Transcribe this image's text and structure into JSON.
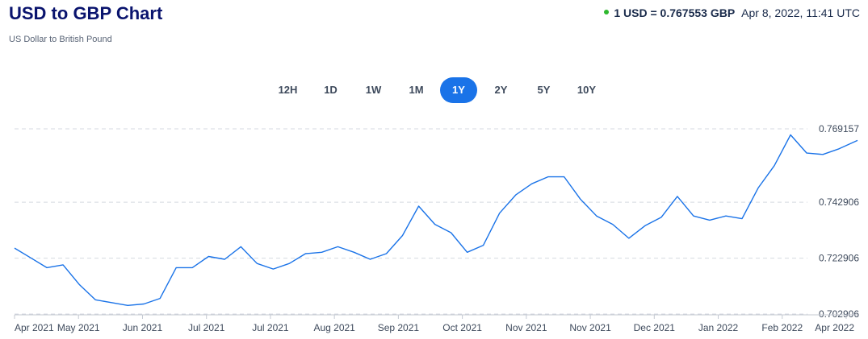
{
  "header": {
    "title": "USD to GBP Chart",
    "subtitle": "US Dollar to British Pound",
    "rate": "1 USD = 0.767553 GBP",
    "timestamp": "Apr 8, 2022, 11:41 UTC",
    "live_dot_color": "#2eb82e"
  },
  "ranges": [
    {
      "label": "12H",
      "active": false
    },
    {
      "label": "1D",
      "active": false
    },
    {
      "label": "1W",
      "active": false
    },
    {
      "label": "1M",
      "active": false
    },
    {
      "label": "1Y",
      "active": true
    },
    {
      "label": "2Y",
      "active": false
    },
    {
      "label": "5Y",
      "active": false
    },
    {
      "label": "10Y",
      "active": false
    }
  ],
  "chart_data": {
    "type": "line",
    "title": "",
    "xlabel": "",
    "ylabel": "",
    "ylim": [
      0.702906,
      0.769157
    ],
    "yticks": [
      "0.769157",
      "0.742906",
      "0.722906",
      "0.702906"
    ],
    "xticks": [
      "Apr 2021",
      "May 2021",
      "Jun 2021",
      "Jul 2021",
      "Jul 2021",
      "Aug 2021",
      "Sep 2021",
      "Oct 2021",
      "Nov 2021",
      "Nov 2021",
      "Dec 2021",
      "Jan 2022",
      "Feb 2022",
      "Apr 2022"
    ],
    "grid": "horizontal dashed",
    "line_color": "#1a73e8",
    "series": [
      {
        "x": [
          "2021-04-08",
          "2021-04-15",
          "2021-04-22",
          "2021-04-29",
          "2021-05-06",
          "2021-05-13",
          "2021-05-20",
          "2021-05-27",
          "2021-06-03",
          "2021-06-10",
          "2021-06-17",
          "2021-06-24",
          "2021-07-01",
          "2021-07-08",
          "2021-07-15",
          "2021-07-22",
          "2021-07-29",
          "2021-08-05",
          "2021-08-12",
          "2021-08-19",
          "2021-08-26",
          "2021-09-02",
          "2021-09-09",
          "2021-09-16",
          "2021-09-23",
          "2021-09-30",
          "2021-10-07",
          "2021-10-14",
          "2021-10-21",
          "2021-10-28",
          "2021-11-04",
          "2021-11-11",
          "2021-11-18",
          "2021-11-25",
          "2021-12-02",
          "2021-12-09",
          "2021-12-16",
          "2021-12-23",
          "2021-12-30",
          "2022-01-06",
          "2022-01-13",
          "2022-01-20",
          "2022-01-27",
          "2022-02-03",
          "2022-02-10",
          "2022-02-17",
          "2022-02-24",
          "2022-03-03",
          "2022-03-10",
          "2022-03-17",
          "2022-03-24",
          "2022-03-31",
          "2022-04-08"
        ],
        "values": [
          0.7265,
          0.723,
          0.7195,
          0.7205,
          0.7135,
          0.708,
          0.707,
          0.706,
          0.7065,
          0.7085,
          0.7195,
          0.7195,
          0.7235,
          0.7225,
          0.727,
          0.721,
          0.719,
          0.721,
          0.7245,
          0.725,
          0.727,
          0.725,
          0.7225,
          0.7245,
          0.731,
          0.7415,
          0.735,
          0.732,
          0.725,
          0.7275,
          0.739,
          0.7455,
          0.7495,
          0.752,
          0.752,
          0.744,
          0.738,
          0.735,
          0.73,
          0.7345,
          0.7375,
          0.745,
          0.738,
          0.7365,
          0.738,
          0.737,
          0.748,
          0.756,
          0.767,
          0.7605,
          0.76,
          0.762,
          0.765
        ]
      }
    ]
  }
}
